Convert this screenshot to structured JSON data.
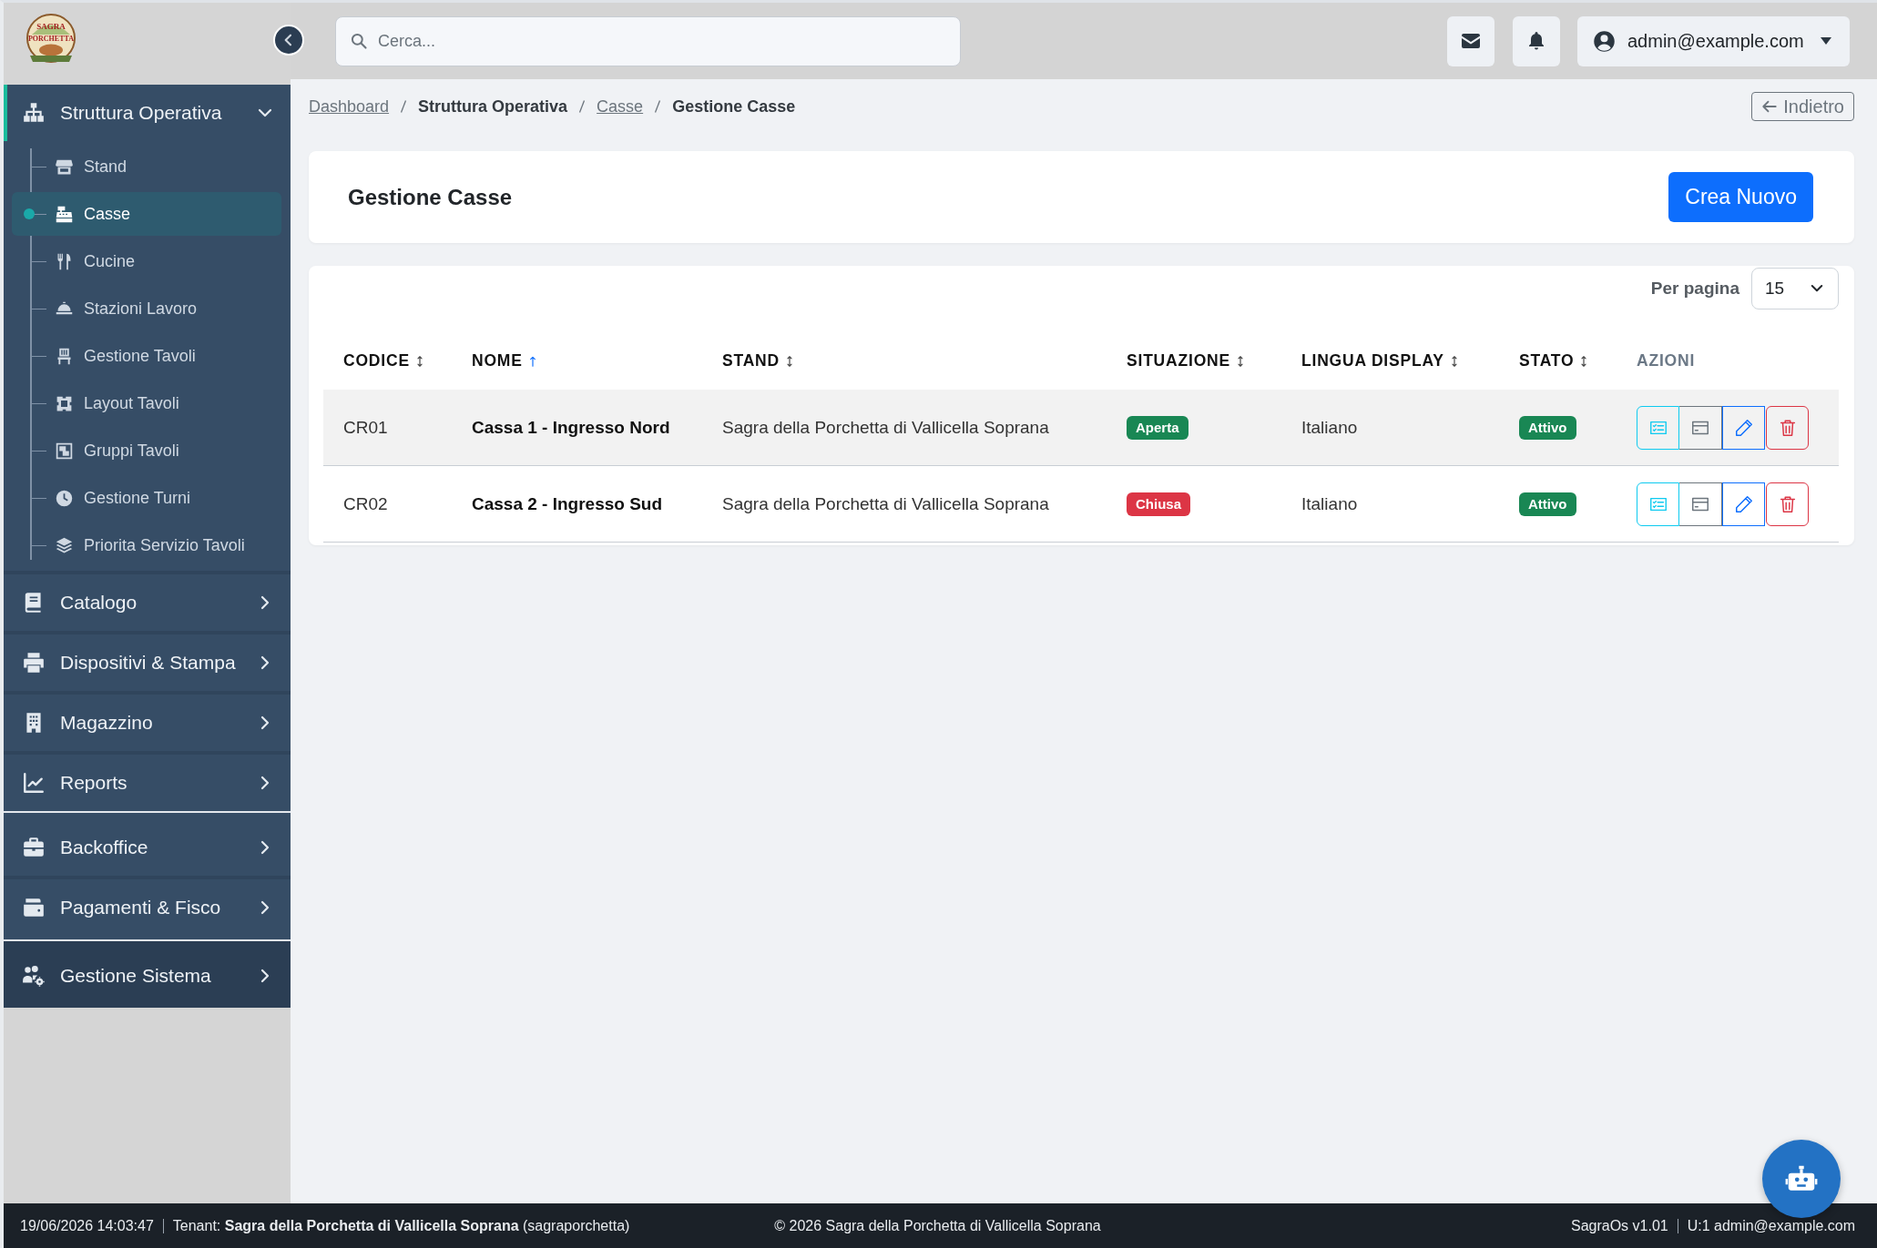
{
  "sidebar": {
    "logo": {
      "lines": [
        "SAGRA",
        "PORCHETTA"
      ]
    },
    "groups": [
      {
        "items": [
          {
            "label": "Struttura Operativa",
            "expanded": true,
            "children": [
              {
                "label": "Stand",
                "selected": false
              },
              {
                "label": "Casse",
                "selected": true
              },
              {
                "label": "Cucine",
                "selected": false
              },
              {
                "label": "Stazioni Lavoro",
                "selected": false
              },
              {
                "label": "Gestione Tavoli",
                "selected": false
              },
              {
                "label": "Layout Tavoli",
                "selected": false
              },
              {
                "label": "Gruppi Tavoli",
                "selected": false
              },
              {
                "label": "Gestione Turni",
                "selected": false
              },
              {
                "label": "Priorita Servizio Tavoli",
                "selected": false
              }
            ]
          },
          {
            "label": "Catalogo",
            "expanded": false
          },
          {
            "label": "Dispositivi & Stampa",
            "expanded": false
          },
          {
            "label": "Magazzino",
            "expanded": false
          },
          {
            "label": "Reports",
            "expanded": false
          }
        ]
      },
      {
        "items": [
          {
            "label": "Backoffice",
            "expanded": false
          },
          {
            "label": "Pagamenti & Fisco",
            "expanded": false
          }
        ]
      },
      {
        "items": [
          {
            "label": "Gestione Sistema",
            "expanded": false
          }
        ]
      }
    ]
  },
  "topbar": {
    "search": {
      "placeholder": "Cerca..."
    },
    "user": "admin@example.com"
  },
  "breadcrumb": [
    {
      "label": "Dashboard",
      "link": true
    },
    {
      "label": "Struttura Operativa",
      "link": false
    },
    {
      "label": "Casse",
      "link": true
    },
    {
      "label": "Gestione Casse",
      "link": false
    }
  ],
  "back_button": "Indietro",
  "page": {
    "title": "Gestione Casse",
    "create_button": "Crea Nuovo"
  },
  "table": {
    "per_page": {
      "label": "Per pagina",
      "value": "15"
    },
    "columns": [
      {
        "label": "CODICE",
        "sortable": true,
        "sorted": false
      },
      {
        "label": "NOME",
        "sortable": true,
        "sorted": true
      },
      {
        "label": "STAND",
        "sortable": true,
        "sorted": false
      },
      {
        "label": "SITUAZIONE",
        "sortable": true,
        "sorted": false
      },
      {
        "label": "LINGUA DISPLAY",
        "sortable": true,
        "sorted": false
      },
      {
        "label": "STATO",
        "sortable": true,
        "sorted": false
      },
      {
        "label": "AZIONI",
        "sortable": false,
        "sorted": false
      }
    ],
    "rows": [
      {
        "codice": "CR01",
        "nome": "Cassa 1 - Ingresso Nord",
        "stand": "Sagra della Porchetta di Vallicella Soprana",
        "situazione": {
          "text": "Aperta",
          "color": "#198754"
        },
        "lingua": "Italiano",
        "stato": {
          "text": "Attivo",
          "color": "#198754"
        }
      },
      {
        "codice": "CR02",
        "nome": "Cassa 2 - Ingresso Sud",
        "stand": "Sagra della Porchetta di Vallicella Soprana",
        "situazione": {
          "text": "Chiusa",
          "color": "#dc3545"
        },
        "lingua": "Italiano",
        "stato": {
          "text": "Attivo",
          "color": "#198754"
        }
      }
    ]
  },
  "footer": {
    "datetime": "19/06/2026 14:03:47",
    "tenant": "Tenant: **Sagra della Porchetta di Vallicella Soprana** (sagraporchetta)",
    "copyright": "© 2026 Sagra della Porchetta di Vallicella Soprana",
    "version": "SagraOs v1.01",
    "user": "U:1 admin@example.com"
  }
}
